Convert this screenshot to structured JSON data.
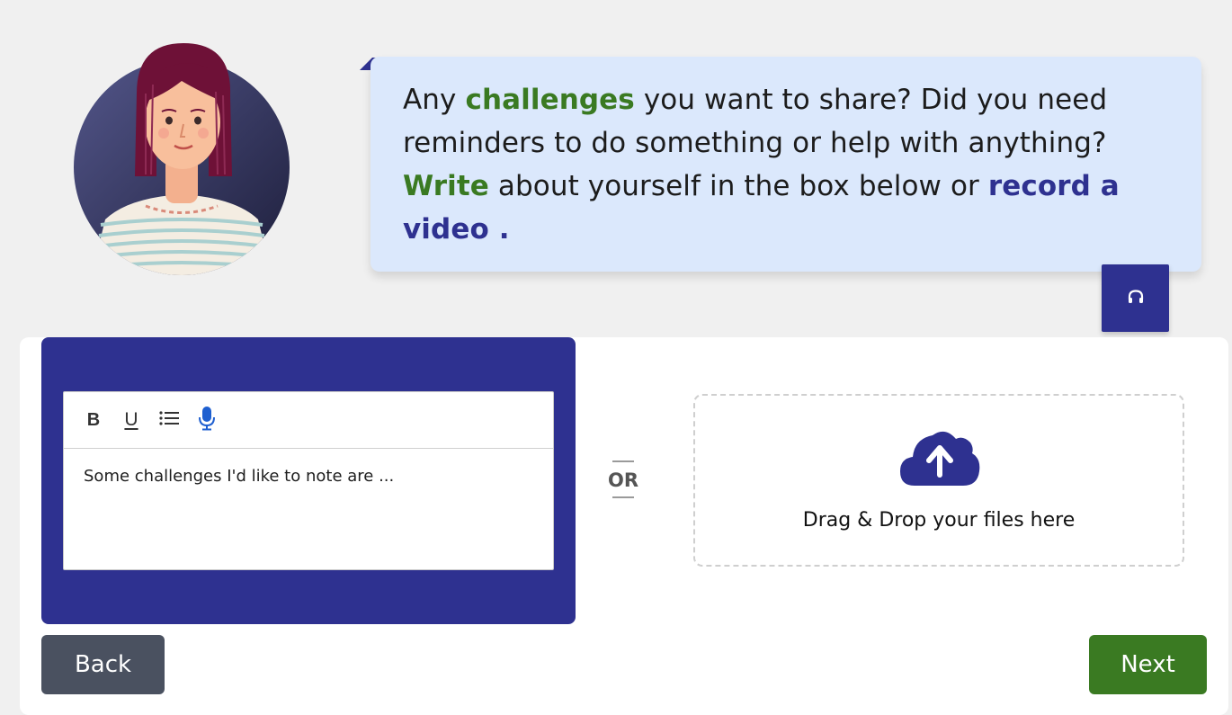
{
  "prompt": {
    "part1": "Any ",
    "highlight1": "challenges",
    "part2": " you want to share? Did you need reminders to do something or help with anything? ",
    "highlight2": "Write",
    "part3": " about yourself in the box below or ",
    "highlight3": "record a video ."
  },
  "editor": {
    "bold_label": "B",
    "underline_label": "U",
    "list_icon": "bulleted-list-icon",
    "mic_icon": "microphone-icon",
    "content": "Some challenges I'd like to note are ..."
  },
  "separator": {
    "or_label": "OR"
  },
  "dropzone": {
    "icon": "cloud-upload-icon",
    "label": "Drag & Drop your files here"
  },
  "nav": {
    "back_label": "Back",
    "next_label": "Next"
  },
  "colors": {
    "brand_blue": "#2e3190",
    "accent_green": "#3a7a22",
    "bubble_bg": "#dbe8fc",
    "back_button": "#4a5160"
  },
  "icons": {
    "audio": "headphones-icon",
    "avatar": "woman-avatar"
  }
}
